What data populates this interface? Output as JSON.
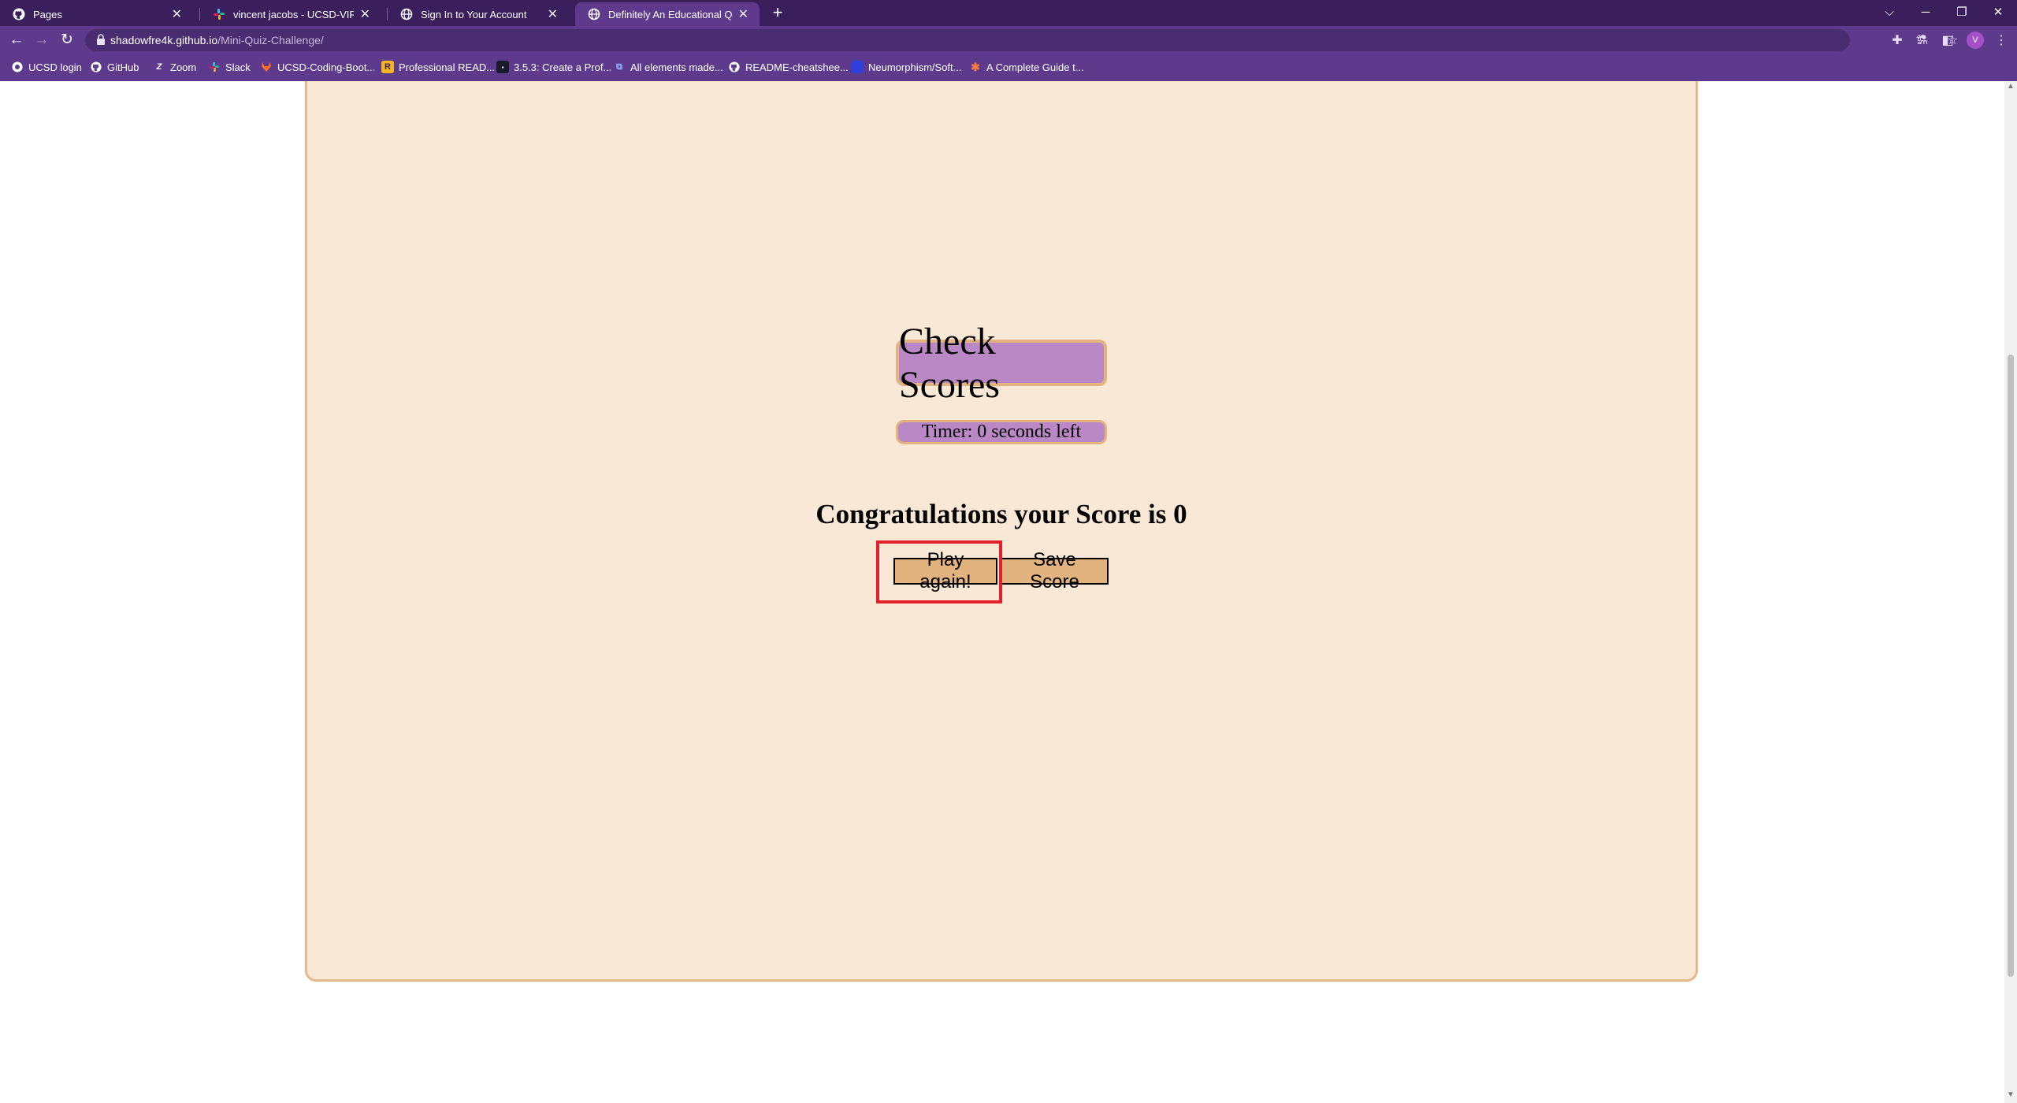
{
  "browser": {
    "tabs": [
      {
        "title": "Pages",
        "icon": "github-icon",
        "active": false
      },
      {
        "title": "vincent jacobs - UCSD-VIRT-FSF",
        "icon": "slack-icon",
        "active": false
      },
      {
        "title": "Sign In to Your Account",
        "icon": "globe-icon",
        "active": false
      },
      {
        "title": "Definitely An Educational Quiz",
        "icon": "globe-icon",
        "active": true
      }
    ],
    "new_tab_label": "+",
    "url_host": "shadowfre4k.github.io",
    "url_path": "/Mini-Quiz-Challenge/",
    "profile_initial": "V",
    "bookmarks": [
      {
        "label": "UCSD login",
        "icon": "ucsd-icon"
      },
      {
        "label": "GitHub",
        "icon": "github-icon"
      },
      {
        "label": "Zoom",
        "icon": "zoom-icon"
      },
      {
        "label": "Slack",
        "icon": "slack-icon"
      },
      {
        "label": "UCSD-Coding-Boot...",
        "icon": "gitlab-icon"
      },
      {
        "label": "Professional READ...",
        "icon": "readme-icon"
      },
      {
        "label": "3.5.3: Create a Prof...",
        "icon": "bootcamp-icon"
      },
      {
        "label": "All elements made...",
        "icon": "elements-icon"
      },
      {
        "label": "README-cheatshee...",
        "icon": "github-icon"
      },
      {
        "label": "Neumorphism/Soft...",
        "icon": "neumorphism-icon"
      },
      {
        "label": "A Complete Guide t...",
        "icon": "css-tricks-icon"
      }
    ]
  },
  "page": {
    "check_scores_label": "Check Scores",
    "timer_text": "Timer: 0 seconds left",
    "score_message": "Congratulations your Score is 0",
    "play_again_label": "Play again!",
    "save_score_label": "Save Score"
  },
  "colors": {
    "card_background": "#f9e8d5",
    "card_border": "#e6b98c",
    "pill_background": "#bb88c6",
    "button_background": "#e3b37f",
    "highlight": "#e0202a",
    "chrome_dark": "#3b1f5c",
    "chrome": "#5e3a8c"
  }
}
